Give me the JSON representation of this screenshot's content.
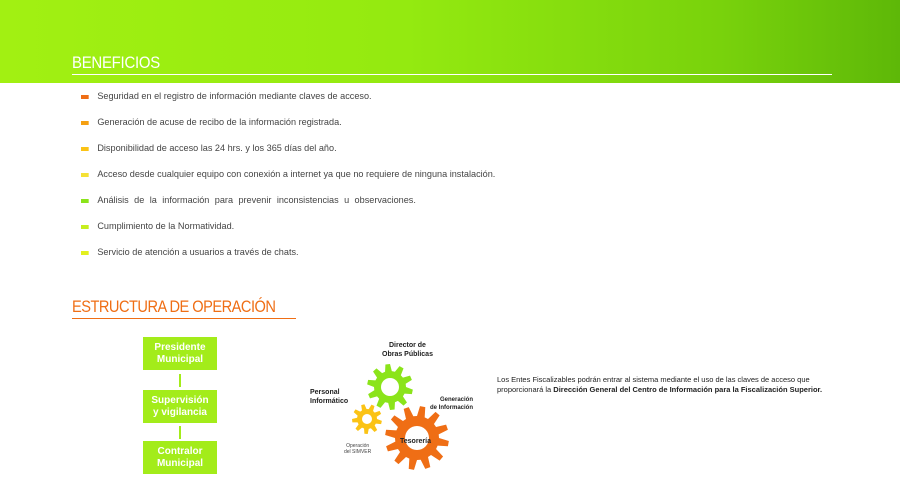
{
  "header": {
    "title": "BENEFICIOS"
  },
  "benefits": [
    {
      "text": "Seguridad en el registro de información mediante claves de acceso.",
      "color": "#ef6e15"
    },
    {
      "text": "Generación de acuse de recibo de la información registrada.",
      "color": "#f5a012"
    },
    {
      "text": "Disponibilidad de acceso las 24 hrs. y los 365 días del año.",
      "color": "#fbc315"
    },
    {
      "text": "Acceso desde cualquier equipo con conexión a internet ya que no requiere de ninguna instalación.",
      "color": "#f5e135"
    },
    {
      "text": "Análisis de la información para prevenir inconsistencias u observaciones.",
      "color": "#8be41a"
    },
    {
      "text": "Cumplimiento de la Normatividad.",
      "color": "#c6ee1f"
    },
    {
      "text": "Servicio de atención a usuarios a través de chats.",
      "color": "#e3f01f"
    }
  ],
  "structure": {
    "title": "ESTRUCTURA DE OPERACIÓN",
    "org_chart": [
      {
        "line1": "Presidente",
        "line2": "Municipal"
      },
      {
        "line1": "Supervisión",
        "line2": "y vigilancia"
      },
      {
        "line1": "Contralor",
        "line2": "Municipal"
      }
    ]
  },
  "gears": {
    "director_line1": "Director de",
    "director_line2": "Obras Públicas",
    "personal_line1": "Personal",
    "personal_line2": "Informático",
    "generacion_line1": "Generación",
    "generacion_line2": "de Información",
    "operacion_line1": "Operación",
    "operacion_line2": "del SIMVER",
    "tesoreria": "Tesorería",
    "colors": {
      "green": "#8be41a",
      "orange": "#ef6e15",
      "yellow": "#fbc315"
    }
  },
  "description": {
    "text_part1": "Los Entes Fiscalizables podrán entrar al sistema mediante el uso de las claves de acceso que proporcionará la ",
    "text_bold": "Dirección General del Centro de Información para la Fiscalización Superior."
  },
  "theme": {
    "accent_green": "#94ea10",
    "accent_orange": "#ef6e15"
  }
}
